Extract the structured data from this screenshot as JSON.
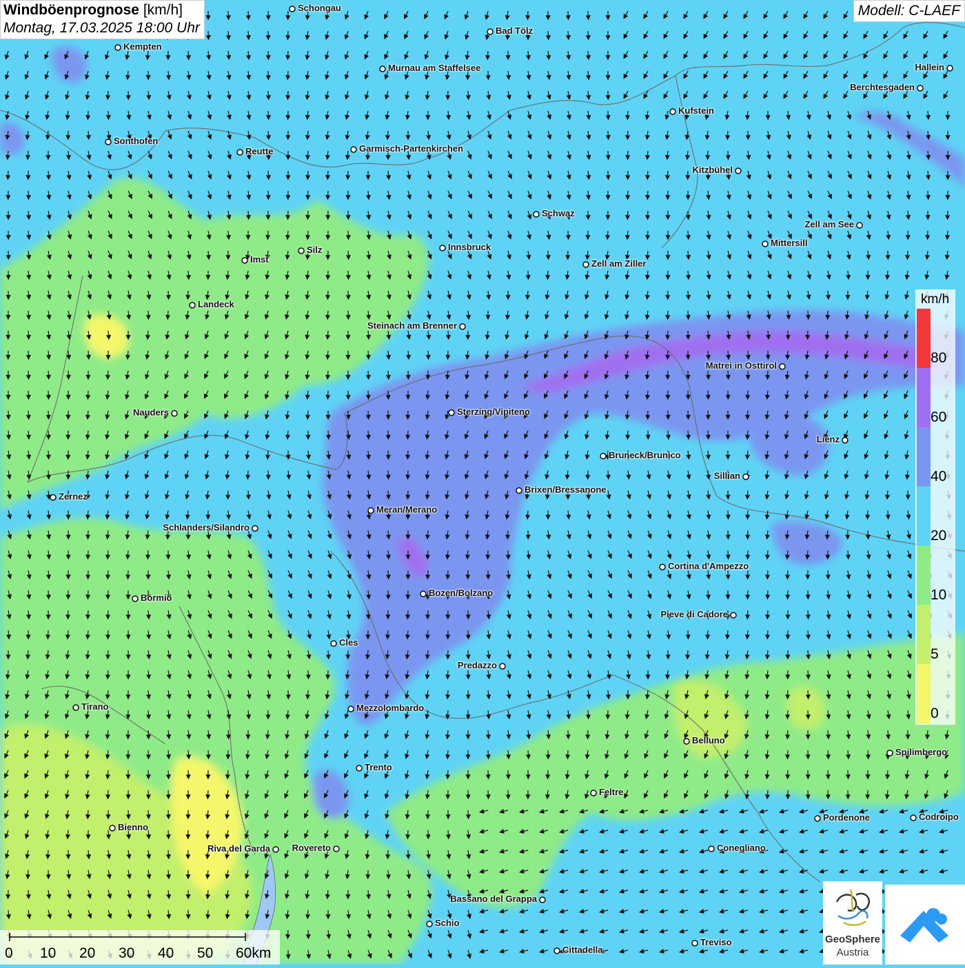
{
  "header": {
    "title_bold": "Windböenprognose",
    "title_unit": "[km/h]",
    "subtitle": "Montag, 17.03.2025 18:00 Uhr",
    "model": "Modell: C-LAEF"
  },
  "legend": {
    "unit": "km/h",
    "labels": [
      "80",
      "60",
      "40",
      "20",
      "10",
      "5",
      "0"
    ],
    "colors": {
      "0_5": "#f5f76a",
      "5_10": "#c2ef6c",
      "10_20": "#8feb87",
      "20_40": "#5fd3f5",
      "40_60": "#7a96f0",
      "60_80": "#a06ef0",
      "80_plus": "#f2383a"
    }
  },
  "scale_bar": {
    "labels": [
      "0",
      "10",
      "20",
      "30",
      "40",
      "50",
      "60km"
    ]
  },
  "cities": [
    {
      "name": "Schongau"
    },
    {
      "name": "Bad Tölz"
    },
    {
      "name": "Kempten"
    },
    {
      "name": "Murnau am Staffelsee"
    },
    {
      "name": "Hallein"
    },
    {
      "name": "Berchtesgaden"
    },
    {
      "name": "Kufstein"
    },
    {
      "name": "Sonthofen"
    },
    {
      "name": "Reutte"
    },
    {
      "name": "Garmisch-Partenkirchen"
    },
    {
      "name": "Kitzbühel"
    },
    {
      "name": "Schwaz"
    },
    {
      "name": "Zell am See"
    },
    {
      "name": "Mittersill"
    },
    {
      "name": "Innsbruck"
    },
    {
      "name": "Silz"
    },
    {
      "name": "Imst"
    },
    {
      "name": "Zell am Ziller"
    },
    {
      "name": "Landeck"
    },
    {
      "name": "Steinach am Brenner"
    },
    {
      "name": "Matrei in Osttirol"
    },
    {
      "name": "Nauders"
    },
    {
      "name": "Sterzing/Vipiteno"
    },
    {
      "name": "Lienz"
    },
    {
      "name": "Bruneck/Brunico"
    },
    {
      "name": "Sillian"
    },
    {
      "name": "Zernez"
    },
    {
      "name": "Brixen/Bressanone"
    },
    {
      "name": "Meran/Merano"
    },
    {
      "name": "Schlanders/Silandro"
    },
    {
      "name": "Cortina d'Ampezzo"
    },
    {
      "name": "Bozen/Bolzano"
    },
    {
      "name": "Bormio"
    },
    {
      "name": "Pieve di Cadore"
    },
    {
      "name": "Cles"
    },
    {
      "name": "Predazzo"
    },
    {
      "name": "Tirano"
    },
    {
      "name": "Mezzolombardo"
    },
    {
      "name": "Belluno"
    },
    {
      "name": "Spilimbergo"
    },
    {
      "name": "Trento"
    },
    {
      "name": "Feltre"
    },
    {
      "name": "Pordenone"
    },
    {
      "name": "Codroipo"
    },
    {
      "name": "Bienno"
    },
    {
      "name": "Riva del Garda"
    },
    {
      "name": "Rovereto"
    },
    {
      "name": "Conegliano"
    },
    {
      "name": "Bassano del Grappa"
    },
    {
      "name": "Schio"
    },
    {
      "name": "Treviso"
    },
    {
      "name": "Cittadella"
    }
  ],
  "logo": {
    "line1": "GeoSphere",
    "line2": "Austria"
  }
}
